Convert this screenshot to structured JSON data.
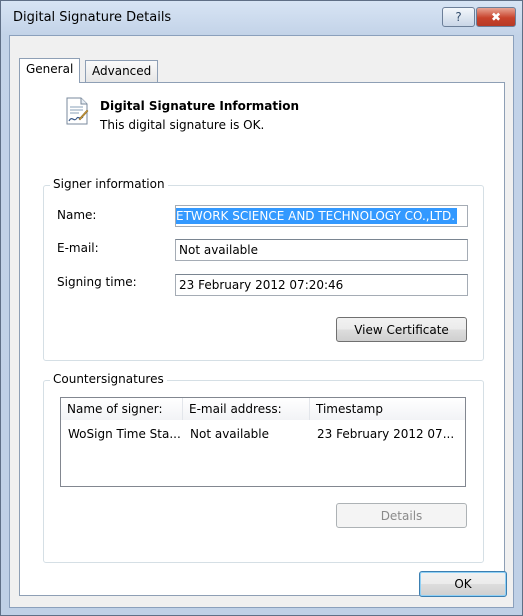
{
  "window": {
    "title": "Digital Signature Details",
    "help_label": "?",
    "close_label": "✖"
  },
  "tabs": [
    {
      "label": "General",
      "active": true
    },
    {
      "label": "Advanced",
      "active": false
    }
  ],
  "header": {
    "icon": "signed-document-icon",
    "title": "Digital Signature Information",
    "status": "This digital signature is OK."
  },
  "signer": {
    "legend": "Signer information",
    "name_label": "Name:",
    "name_value": "ETWORK SCIENCE AND TECHNOLOGY CO.,LTD.",
    "email_label": "E-mail:",
    "email_value": "Not available",
    "time_label": "Signing time:",
    "time_value": " 23  February  2012 07:20:46",
    "view_certificate_label": "View Certificate"
  },
  "countersignatures": {
    "legend": "Countersignatures",
    "columns": [
      "Name of signer:",
      "E-mail address:",
      "Timestamp"
    ],
    "rows": [
      {
        "name": "WoSign Time Sta...",
        "email": "Not available",
        "timestamp": "23 February 2012 07..."
      }
    ],
    "details_label": "Details"
  },
  "footer": {
    "ok_label": "OK"
  },
  "colors": {
    "selection": "#3399ff",
    "title_bar": "#c7d6ea",
    "close_button": "#c8432c"
  }
}
